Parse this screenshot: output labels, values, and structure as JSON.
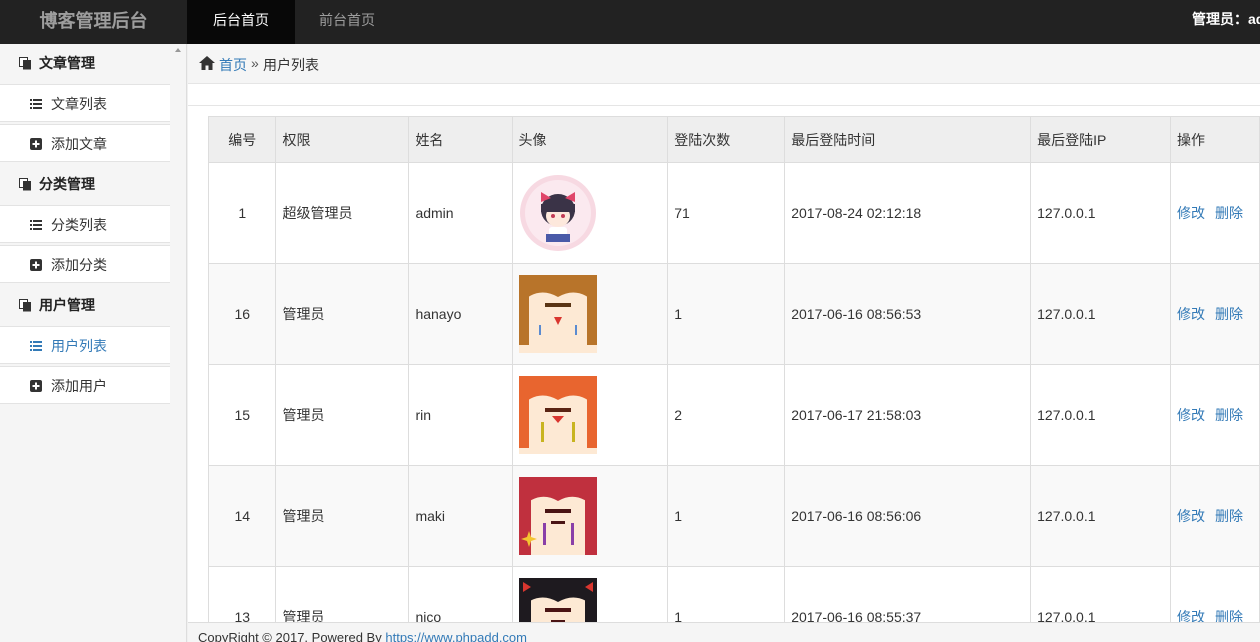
{
  "navbar": {
    "brand": "博客管理后台",
    "tab_active": "后台首页",
    "tab_front": "前台首页",
    "user_label": "管理员：admin"
  },
  "sidebar": {
    "sections": [
      {
        "title": "文章管理",
        "items": [
          {
            "label": "文章列表",
            "icon": "list-icon"
          },
          {
            "label": "添加文章",
            "icon": "plus-square-icon"
          }
        ]
      },
      {
        "title": "分类管理",
        "items": [
          {
            "label": "分类列表",
            "icon": "list-icon"
          },
          {
            "label": "添加分类",
            "icon": "plus-square-icon"
          }
        ]
      },
      {
        "title": "用户管理",
        "items": [
          {
            "label": "用户列表",
            "icon": "list-icon",
            "active": true
          },
          {
            "label": "添加用户",
            "icon": "plus-square-icon"
          }
        ]
      }
    ]
  },
  "breadcrumb": {
    "home": "首页",
    "sep": "»",
    "current": "用户列表"
  },
  "table": {
    "headers": [
      "编号",
      "权限",
      "姓名",
      "头像",
      "登陆次数",
      "最后登陆时间",
      "最后登陆IP",
      "操作"
    ],
    "edit_label": "修改",
    "delete_label": "删除",
    "rows": [
      {
        "id": "1",
        "role": "超级管理员",
        "name": "admin",
        "avatar": "pink-chibi-avatar",
        "logins": "71",
        "last_time": "2017-08-24 02:12:18",
        "last_ip": "127.0.0.1"
      },
      {
        "id": "16",
        "role": "管理员",
        "name": "hanayo",
        "avatar": "brown-hair-avatar",
        "logins": "1",
        "last_time": "2017-06-16 08:56:53",
        "last_ip": "127.0.0.1"
      },
      {
        "id": "15",
        "role": "管理员",
        "name": "rin",
        "avatar": "orange-hair-avatar",
        "logins": "2",
        "last_time": "2017-06-17 21:58:03",
        "last_ip": "127.0.0.1"
      },
      {
        "id": "14",
        "role": "管理员",
        "name": "maki",
        "avatar": "red-hair-avatar",
        "logins": "1",
        "last_time": "2017-06-16 08:56:06",
        "last_ip": "127.0.0.1"
      },
      {
        "id": "13",
        "role": "管理员",
        "name": "nico",
        "avatar": "black-hair-avatar",
        "logins": "1",
        "last_time": "2017-06-16 08:55:37",
        "last_ip": "127.0.0.1"
      }
    ]
  },
  "footer": {
    "text": "CopyRight © 2017. Powered By ",
    "link": "https://www.phpadd.com"
  }
}
